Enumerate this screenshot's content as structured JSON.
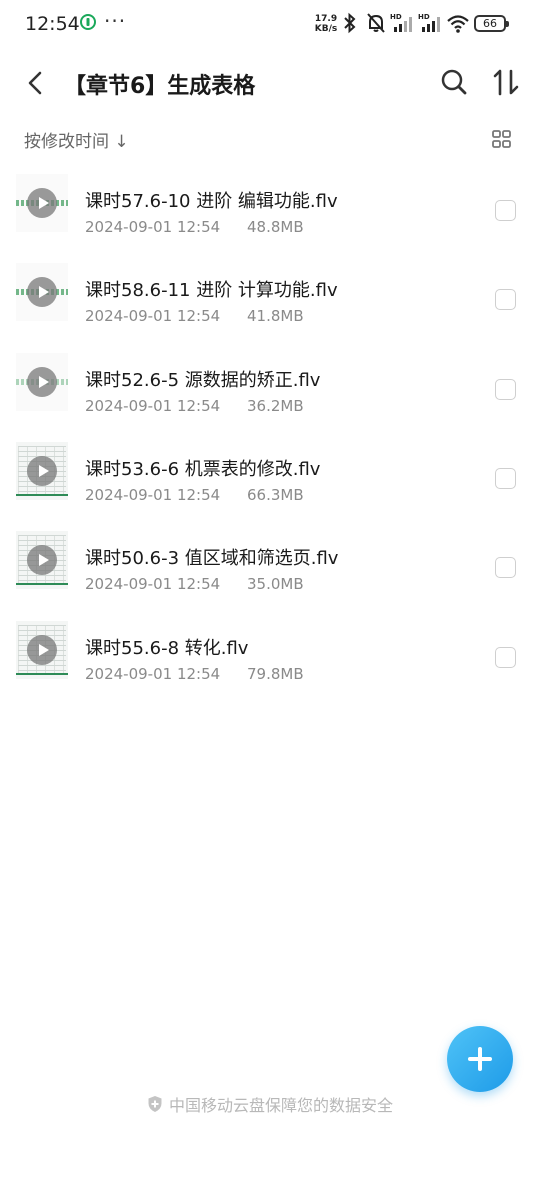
{
  "status_bar": {
    "time": "12:54",
    "net_speed_value": "17.9",
    "net_speed_unit": "KB/s",
    "battery": "66"
  },
  "header": {
    "title": "【章节6】生成表格"
  },
  "sort_bar": {
    "label": "按修改时间 ↓"
  },
  "files": [
    {
      "name": "课时57.6-10 进阶 编辑功能.flv",
      "date": "2024-09-01 12:54",
      "size": "48.8MB"
    },
    {
      "name": "课时58.6-11 进阶 计算功能.flv",
      "date": "2024-09-01 12:54",
      "size": "41.8MB"
    },
    {
      "name": "课时52.6-5 源数据的矫正.flv",
      "date": "2024-09-01 12:54",
      "size": "36.2MB"
    },
    {
      "name": "课时53.6-6 机票表的修改.flv",
      "date": "2024-09-01 12:54",
      "size": "66.3MB"
    },
    {
      "name": "课时50.6-3 值区域和筛选页.flv",
      "date": "2024-09-01 12:54",
      "size": "35.0MB"
    },
    {
      "name": "课时55.6-8 转化.flv",
      "date": "2024-09-01 12:54",
      "size": "79.8MB"
    }
  ],
  "footer": {
    "text": "中国移动云盘保障您的数据安全"
  },
  "colors": {
    "accent": "#1e9be8",
    "text_primary": "#1a1a1a",
    "text_secondary": "#8a8a8a"
  }
}
